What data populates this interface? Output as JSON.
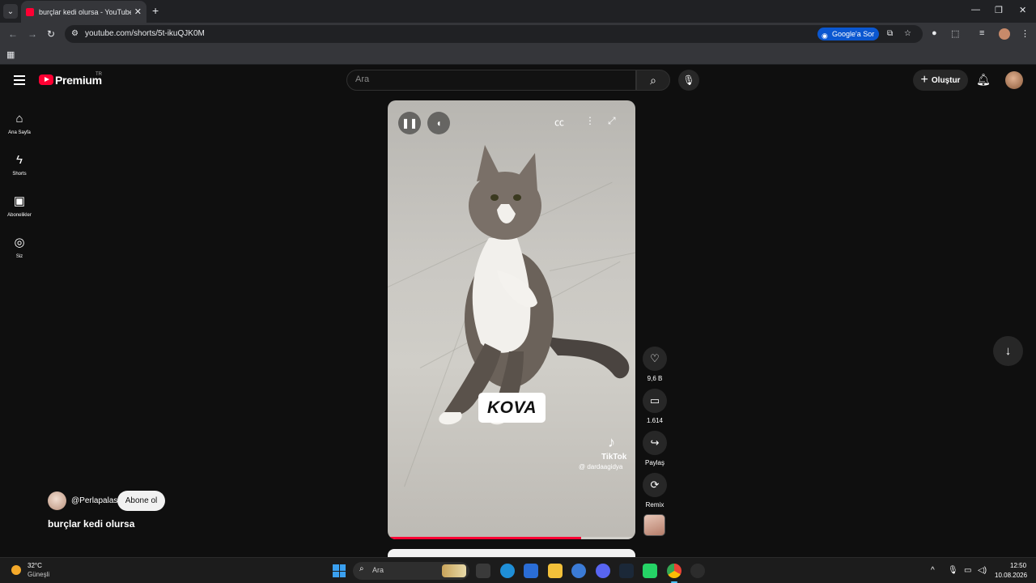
{
  "browser": {
    "tab_title": "burçlar kedi olursa - YouTube",
    "url": "youtube.com/shorts/5t-ikuQJK0M",
    "google_sor_label": "Google'a Sor",
    "icons": [
      "tab-search-icon",
      "close-icon",
      "plus-icon",
      "back-icon",
      "forward-icon",
      "reload-icon",
      "site-info-icon",
      "install-icon",
      "star-icon",
      "extension-icon",
      "media-icon",
      "profile-icon",
      "menu-icon",
      "apps-icon",
      "minimize-icon",
      "maximize-icon",
      "window-close-icon"
    ]
  },
  "masthead": {
    "logo_text": "Premium",
    "country_code": "TR",
    "search_placeholder": "Ara",
    "create_label": "Oluştur"
  },
  "sidebar": {
    "items": [
      {
        "label": "Ana Sayfa",
        "icon": "home-icon"
      },
      {
        "label": "Shorts",
        "icon": "shorts-icon"
      },
      {
        "label": "Abonelikler",
        "icon": "subscriptions-icon"
      },
      {
        "label": "Siz",
        "icon": "you-icon"
      }
    ]
  },
  "player": {
    "overlay_text": "KOVA",
    "watermark_name": "TikTok",
    "watermark_handle": "@ dardaagidya",
    "progress": 0.78,
    "accent_color": "#ff0033"
  },
  "actions": {
    "like_count": "9,6 B",
    "comment_count": "1.614",
    "share_label": "Paylaş",
    "remix_label": "Remix"
  },
  "channel": {
    "handle": "@Perlapalas",
    "subscribe_label": "Abone ol",
    "short_title": "burçlar kedi olursa"
  },
  "taskbar": {
    "weather_temp": "32°C",
    "weather_desc": "Güneşli",
    "search_placeholder": "Ara",
    "time": "12:50",
    "date": "10.08.2026"
  }
}
